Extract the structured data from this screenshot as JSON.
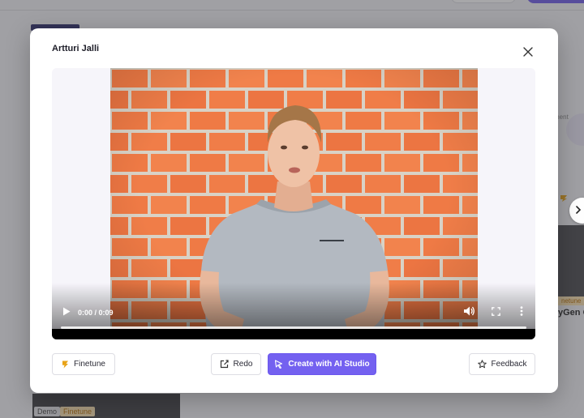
{
  "modal": {
    "title": "Artturi Jalli"
  },
  "player": {
    "time": "0:00 / 0:09",
    "progress_fraction": 0
  },
  "footer": {
    "finetune_label": "Finetune",
    "redo_label": "Redo",
    "create_label": "Create with AI Studio",
    "feedback_label": "Feedback"
  },
  "background": {
    "side_text": "ment",
    "side_badge": "",
    "thumb_badge": "netune",
    "thumb_title": "yGen CE",
    "badge_demo": "Demo",
    "badge_finetune": "Finetune"
  },
  "colors": {
    "accent": "#7461f0",
    "finetune_icon": "#e8a317",
    "badge_finetune_bg": "#fbe2b0"
  },
  "icons": {
    "close": "close-icon",
    "play": "play-icon",
    "volume": "volume-icon",
    "fullscreen": "fullscreen-icon",
    "more": "more-vertical-icon",
    "finetune": "lightning-icon",
    "redo": "edit-icon",
    "create": "cursor-icon",
    "feedback": "star-icon",
    "next": "chevron-right-icon"
  }
}
